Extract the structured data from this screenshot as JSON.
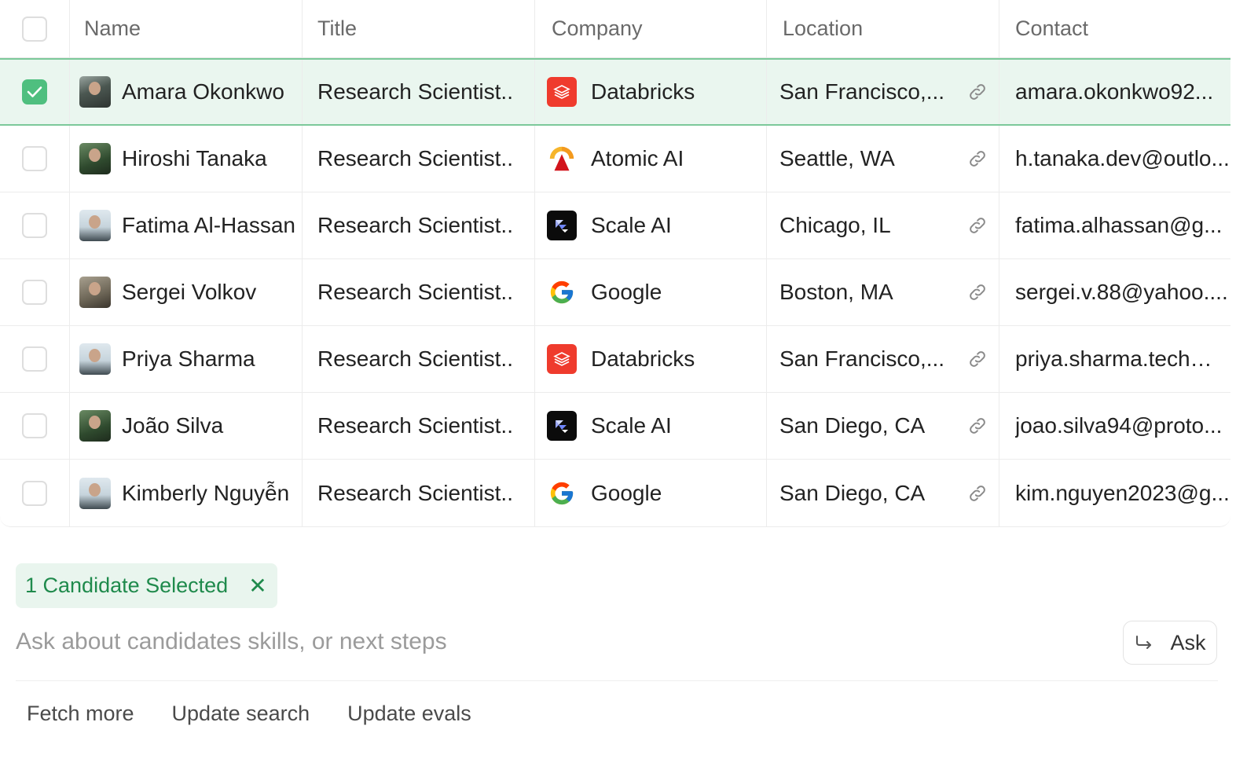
{
  "table": {
    "headers": {
      "name": "Name",
      "title": "Title",
      "company": "Company",
      "location": "Location",
      "contact": "Contact"
    },
    "rows": [
      {
        "name": "Amara Okonkwo",
        "title": "Research Scientist..",
        "company": "Databricks",
        "location": "San Francisco,...",
        "contact": "amara.okonkwo92...",
        "selected": true
      },
      {
        "name": "Hiroshi Tanaka",
        "title": "Research Scientist..",
        "company": "Atomic AI",
        "location": "Seattle, WA",
        "contact": "h.tanaka.dev@outlo...",
        "selected": false
      },
      {
        "name": "Fatima Al-Hassan",
        "title": "Research Scientist..",
        "company": "Scale AI",
        "location": "Chicago, IL",
        "contact": "fatima.alhassan@g...",
        "selected": false
      },
      {
        "name": "Sergei Volkov",
        "title": "Research Scientist..",
        "company": "Google",
        "location": "Boston, MA",
        "contact": "sergei.v.88@yahoo....",
        "selected": false
      },
      {
        "name": "Priya Sharma",
        "title": "Research Scientist..",
        "company": "Databricks",
        "location": "San Francisco,...",
        "contact": "priya.sharma.tech@...",
        "selected": false
      },
      {
        "name": "João Silva",
        "title": "Research Scientist..",
        "company": "Scale AI",
        "location": "San Diego, CA",
        "contact": "joao.silva94@proto...",
        "selected": false
      },
      {
        "name": "Kimberly Nguyễn",
        "title": "Research Scientist..",
        "company": "Google",
        "location": "San Diego, CA",
        "contact": "kim.nguyen2023@g...",
        "selected": false
      }
    ]
  },
  "selection": {
    "chip_label": "1 Candidate Selected",
    "close_glyph": "✕"
  },
  "composer": {
    "placeholder": "Ask about candidates skills, or next steps",
    "ask_label": "Ask"
  },
  "actions": {
    "fetch_more": "Fetch more",
    "update_search": "Update search",
    "update_evals": "Update evals"
  },
  "colors": {
    "accent_green": "#4fbf7f",
    "selected_row_bg": "#eaf6ef",
    "chip_text": "#1f8a4c",
    "databricks_red": "#ef3b2d"
  },
  "icons": {
    "link": "link-icon",
    "check": "check-icon",
    "close": "close-icon",
    "ask": "return-arrow-icon"
  }
}
